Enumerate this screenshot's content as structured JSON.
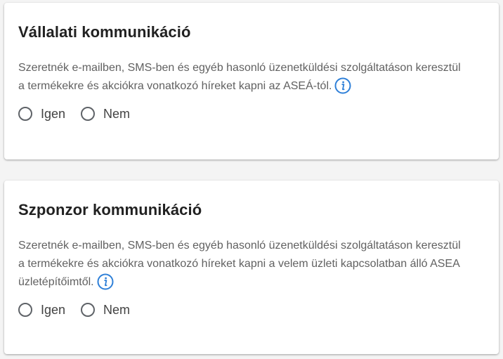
{
  "colors": {
    "info_icon": "#2f80d8",
    "body_text": "#616161",
    "title_text": "#212121"
  },
  "sections": [
    {
      "title": "Vállalati kommunikáció",
      "body": "Szeretnék e-mailben, SMS-ben és egyéb hasonló üzenetküldési szolgáltatáson keresztül a termékekre és akciókra vonatkozó híreket kapni az ASEÁ-tól.",
      "info_icon": "info-circle-icon",
      "options": [
        {
          "label": "Igen",
          "selected": false
        },
        {
          "label": "Nem",
          "selected": false
        }
      ]
    },
    {
      "title": "Szponzor kommunikáció",
      "body": "Szeretnék e-mailben, SMS-ben és egyéb hasonló üzenetküldési szolgáltatáson keresztül a termékekre és akciókra vonatkozó híreket kapni a velem üzleti kapcsolatban álló ASEA üzletépítőimtől.",
      "info_icon": "info-circle-icon",
      "options": [
        {
          "label": "Igen",
          "selected": false
        },
        {
          "label": "Nem",
          "selected": false
        }
      ]
    }
  ]
}
